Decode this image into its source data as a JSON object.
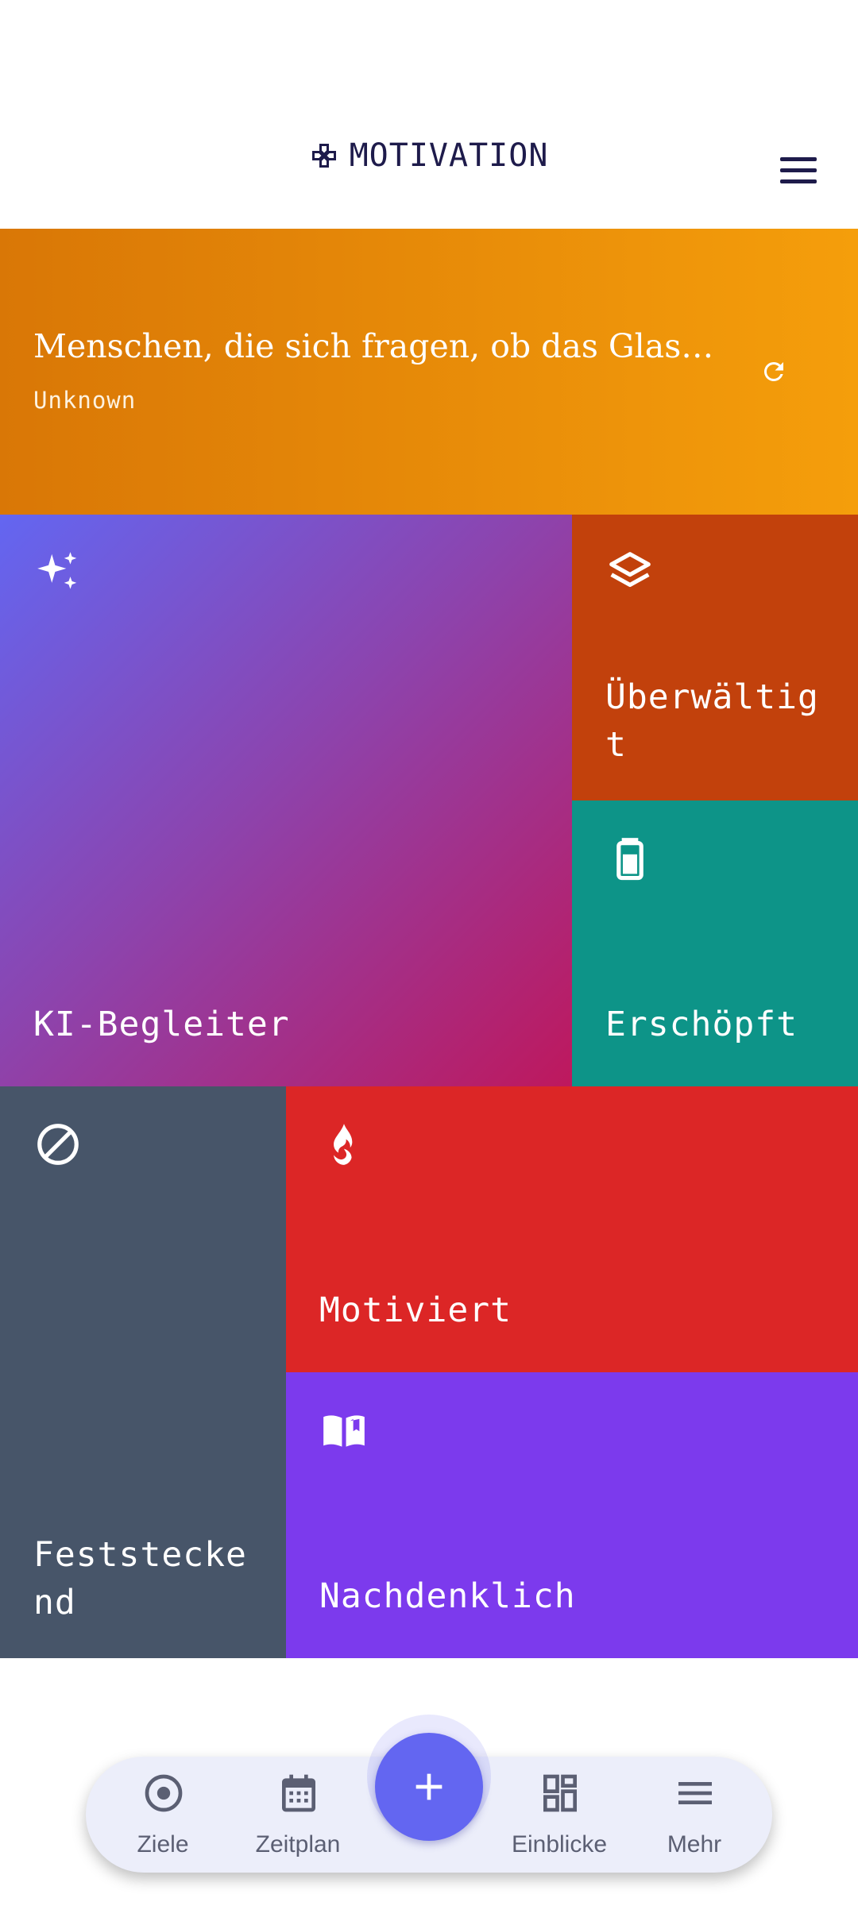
{
  "header": {
    "title": "MOTIVATION",
    "brand_icon": "gamepad-icon",
    "menu_icon": "hamburger-menu-icon"
  },
  "quote": {
    "text": "Menschen, die sich fragen, ob das Glas h…",
    "author": "Unknown",
    "refresh_icon": "refresh-icon",
    "gradient": [
      "#d97706",
      "#f59e0b"
    ]
  },
  "tiles": [
    {
      "label": "KI-Begleiter",
      "icon": "sparkles-icon",
      "color": "#8b45b0"
    },
    {
      "label": "Überwältig\nt",
      "icon": "layers-icon",
      "color": "#c2410c"
    },
    {
      "label": "Erschöpft",
      "icon": "battery-icon",
      "color": "#0d9488"
    },
    {
      "label": "Feststecke\nnd",
      "icon": "blocked-icon",
      "color": "#475569"
    },
    {
      "label": "Motiviert",
      "icon": "flame-icon",
      "color": "#dc2626"
    },
    {
      "label": "Nachdenklich",
      "icon": "book-icon",
      "color": "#7c3aed"
    }
  ],
  "bottom_nav": {
    "items": [
      {
        "label": "Ziele",
        "icon": "target-icon"
      },
      {
        "label": "Zeitplan",
        "icon": "calendar-icon"
      },
      {
        "label": "Einblicke",
        "icon": "dashboard-icon"
      },
      {
        "label": "Mehr",
        "icon": "menu-icon"
      }
    ],
    "fab_icon": "plus-icon",
    "fab_color": "#6366f1"
  }
}
